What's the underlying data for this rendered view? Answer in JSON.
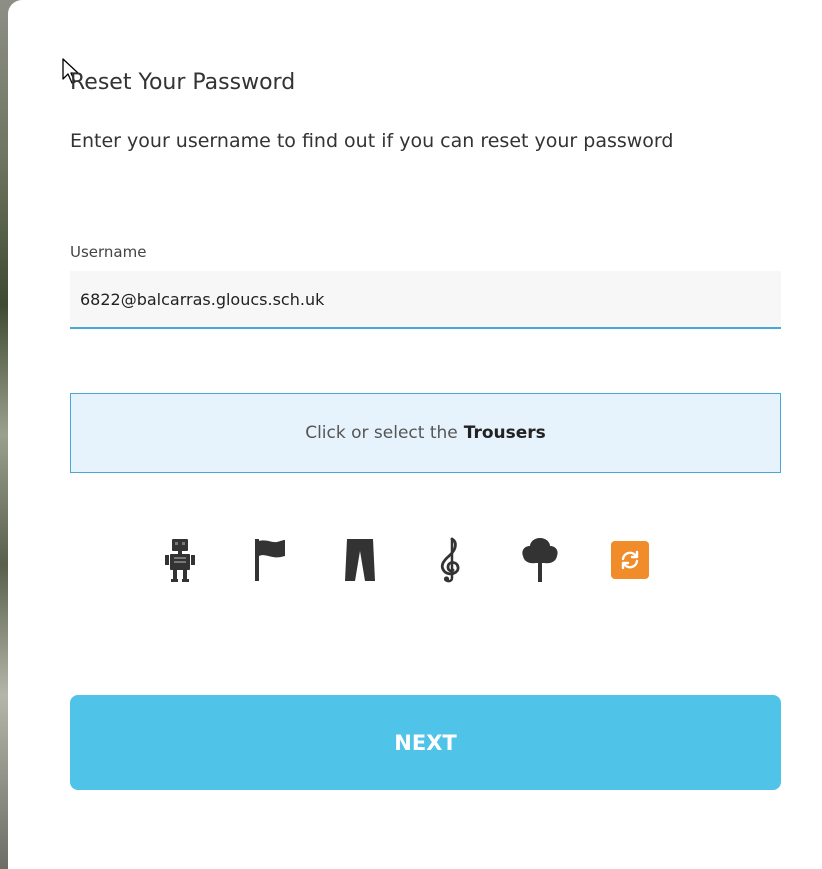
{
  "header": {
    "title": "Reset Your Password",
    "description": "Enter your username to find out if you can reset your password"
  },
  "username": {
    "label": "Username",
    "value": "6822@balcarras.gloucs.sch.uk"
  },
  "captcha": {
    "prompt": "Click or select the",
    "target": "Trousers",
    "icons": [
      "robot-icon",
      "flag-icon",
      "trousers-icon",
      "treble-clef-icon",
      "tree-icon"
    ],
    "refresh_icon": "refresh-icon"
  },
  "actions": {
    "next_label": "NEXT"
  },
  "colors": {
    "accent": "#4aa8d8",
    "next_button": "#50c3e8",
    "refresh_button": "#f08c2a",
    "captcha_bg": "#e6f3fc"
  }
}
